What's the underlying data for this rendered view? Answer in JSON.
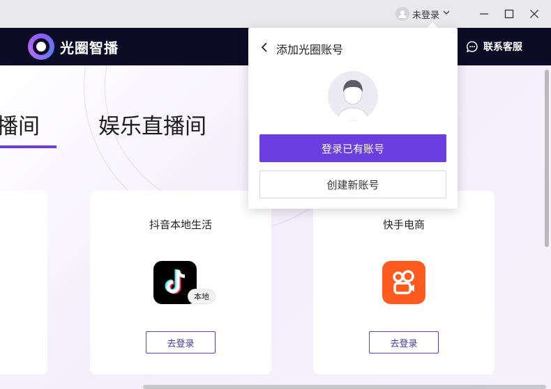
{
  "titlebar": {
    "user_status": "未登录",
    "icons": [
      "user-avatar-icon",
      "chevron-down-icon",
      "minimize-icon",
      "maximize-icon",
      "close-icon"
    ]
  },
  "header": {
    "brand_name": "光圈智播",
    "support_label": "联系客服",
    "background": "#0e0b26"
  },
  "tabs": [
    {
      "label": "直播间",
      "active": true
    },
    {
      "label": "娱乐直播间",
      "active": false
    }
  ],
  "cards": [
    {
      "title": "抖音本地生活",
      "badge": "本地",
      "login_label": "去登录",
      "icon": "douyin-icon"
    },
    {
      "title": "快手电商",
      "login_label": "去登录",
      "icon": "kuaishou-icon"
    }
  ],
  "popup": {
    "title": "添加光圈账号",
    "primary_button": "登录已有账号",
    "secondary_button": "创建新账号"
  },
  "colors": {
    "accent": "#6a3edf",
    "kuaishou": "#ff5a1f",
    "douyin": "#000000"
  }
}
